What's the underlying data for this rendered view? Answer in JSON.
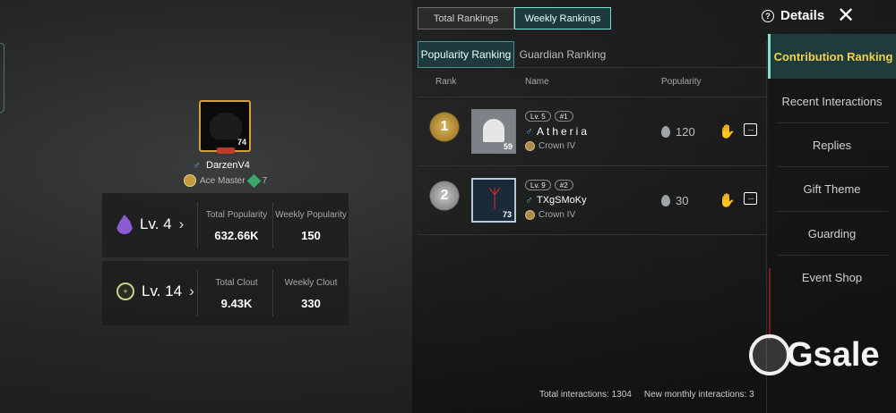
{
  "top_tabs": [
    "Total Rankings",
    "Weekly Rankings"
  ],
  "top_tabs_active": 1,
  "details_label": "Details",
  "profile": {
    "avatar_level": "74",
    "name": "DarzenV4",
    "rank": "Ace Master",
    "rank_num": "7",
    "popularity_block": {
      "level": "Lv. 4",
      "total_label": "Total Popularity",
      "total_value": "632.66K",
      "weekly_label": "Weekly Popularity",
      "weekly_value": "150"
    },
    "clout_block": {
      "level": "Lv. 14",
      "total_label": "Total Clout",
      "total_value": "9.43K",
      "weekly_label": "Weekly Clout",
      "weekly_value": "330"
    }
  },
  "ranking": {
    "sub_tabs": [
      "Popularity Ranking",
      "Guardian Ranking"
    ],
    "columns": [
      "Rank",
      "Name",
      "Popularity"
    ],
    "rows": [
      {
        "rank": "1",
        "avatar_level": "59",
        "lv_pill": "Lv. 5",
        "num_pill": "#1",
        "name": "Atheria",
        "tier": "Crown IV",
        "popularity": "120"
      },
      {
        "rank": "2",
        "avatar_level": "73",
        "lv_pill": "Lv. 9",
        "num_pill": "#2",
        "name": "TXgSMoKy",
        "tier": "Crown IV",
        "popularity": "30"
      }
    ],
    "footer_total": "Total interactions: 1304",
    "footer_monthly": "New monthly interactions: 3"
  },
  "side_menu": [
    "Contribution Ranking",
    "Recent Interactions",
    "Replies",
    "Gift Theme",
    "Guarding",
    "Event Shop"
  ],
  "side_menu_active": 0,
  "watermark": "Gsale",
  "icons": [
    "help-icon",
    "close-icon",
    "flame-icon",
    "sun-icon",
    "male-icon",
    "gift-icon",
    "more-icon"
  ],
  "colors": {
    "accent": "#75e0d5",
    "active_side_text": "#f2d14b",
    "gold": "#d3a13c"
  }
}
